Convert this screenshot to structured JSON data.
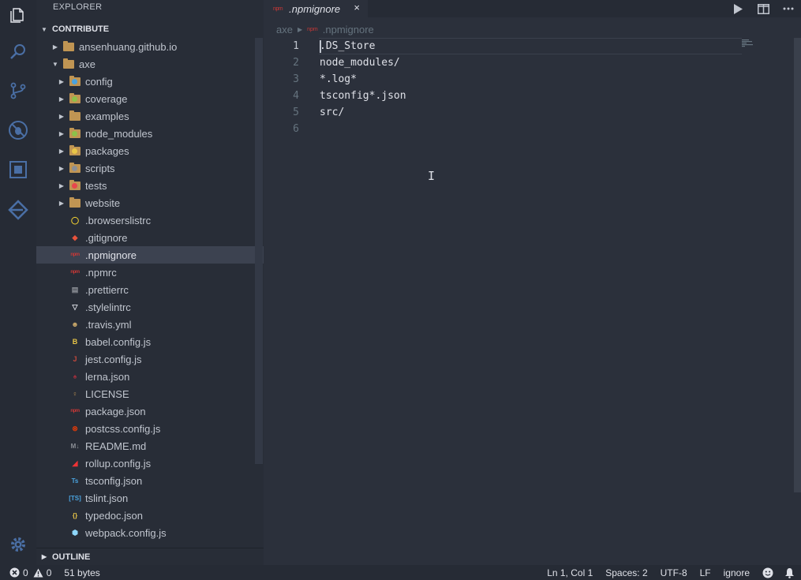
{
  "sidebar": {
    "title": "EXPLORER",
    "section": "CONTRIBUTE",
    "outline": "OUTLINE",
    "tree": [
      {
        "label": "ansenhuang.github.io",
        "kind": "folder",
        "depth": 0,
        "expanded": false,
        "icon": "folder-icon",
        "color": "#c09553"
      },
      {
        "label": "axe",
        "kind": "folder",
        "depth": 0,
        "expanded": true,
        "icon": "folder-open-icon",
        "color": "#c09553"
      },
      {
        "label": "config",
        "kind": "folder",
        "depth": 1,
        "expanded": false,
        "icon": "folder-config-icon",
        "color": "#4aa3df"
      },
      {
        "label": "coverage",
        "kind": "folder",
        "depth": 1,
        "expanded": false,
        "icon": "folder-coverage-icon",
        "color": "#8dc149"
      },
      {
        "label": "examples",
        "kind": "folder",
        "depth": 1,
        "expanded": false,
        "icon": "folder-icon",
        "color": "#c09553"
      },
      {
        "label": "node_modules",
        "kind": "folder",
        "depth": 1,
        "expanded": false,
        "icon": "folder-node-icon",
        "color": "#8dc149"
      },
      {
        "label": "packages",
        "kind": "folder",
        "depth": 1,
        "expanded": false,
        "icon": "folder-packages-icon",
        "color": "#e8c547"
      },
      {
        "label": "scripts",
        "kind": "folder",
        "depth": 1,
        "expanded": false,
        "icon": "folder-scripts-icon",
        "color": "#8b8f96"
      },
      {
        "label": "tests",
        "kind": "folder",
        "depth": 1,
        "expanded": false,
        "icon": "folder-tests-icon",
        "color": "#e8474c"
      },
      {
        "label": "website",
        "kind": "folder",
        "depth": 1,
        "expanded": false,
        "icon": "folder-icon",
        "color": "#c09553"
      },
      {
        "label": ".browserslistrc",
        "kind": "file",
        "depth": 1,
        "icon": "browserslist-icon",
        "glyph": "◯",
        "color": "#f2d131"
      },
      {
        "label": ".gitignore",
        "kind": "file",
        "depth": 1,
        "icon": "git-icon",
        "glyph": "◆",
        "color": "#e8533c"
      },
      {
        "label": ".npmignore",
        "kind": "file",
        "depth": 1,
        "icon": "npm-icon",
        "glyph": "npm",
        "color": "#cb3837",
        "selected": true
      },
      {
        "label": ".npmrc",
        "kind": "file",
        "depth": 1,
        "icon": "npm-icon",
        "glyph": "npm",
        "color": "#cb3837"
      },
      {
        "label": ".prettierrc",
        "kind": "file",
        "depth": 1,
        "icon": "prettier-icon",
        "glyph": "▤",
        "color": "#8b8f96"
      },
      {
        "label": ".stylelintrc",
        "kind": "file",
        "depth": 1,
        "icon": "stylelint-icon",
        "glyph": "▽",
        "color": "#dfe1e8"
      },
      {
        "label": ".travis.yml",
        "kind": "file",
        "depth": 1,
        "icon": "travis-icon",
        "glyph": "☻",
        "color": "#c9a86a"
      },
      {
        "label": "babel.config.js",
        "kind": "file",
        "depth": 1,
        "icon": "babel-icon",
        "glyph": "B",
        "color": "#e8c547"
      },
      {
        "label": "jest.config.js",
        "kind": "file",
        "depth": 1,
        "icon": "jest-icon",
        "glyph": "J",
        "color": "#c3483c"
      },
      {
        "label": "lerna.json",
        "kind": "file",
        "depth": 1,
        "icon": "lerna-icon",
        "glyph": "♠",
        "color": "#9b2f3c"
      },
      {
        "label": "LICENSE",
        "kind": "file",
        "depth": 1,
        "icon": "license-icon",
        "glyph": "♀",
        "color": "#c09553"
      },
      {
        "label": "package.json",
        "kind": "file",
        "depth": 1,
        "icon": "npm-icon",
        "glyph": "npm",
        "color": "#cb3837"
      },
      {
        "label": "postcss.config.js",
        "kind": "file",
        "depth": 1,
        "icon": "postcss-icon",
        "glyph": "⊗",
        "color": "#dd3a0a"
      },
      {
        "label": "README.md",
        "kind": "file",
        "depth": 1,
        "icon": "markdown-icon",
        "glyph": "M↓",
        "color": "#8b8f96"
      },
      {
        "label": "rollup.config.js",
        "kind": "file",
        "depth": 1,
        "icon": "rollup-icon",
        "glyph": "◢",
        "color": "#ef3335"
      },
      {
        "label": "tsconfig.json",
        "kind": "file",
        "depth": 1,
        "icon": "typescript-icon",
        "glyph": "Ts",
        "color": "#4aa3df"
      },
      {
        "label": "tslint.json",
        "kind": "file",
        "depth": 1,
        "icon": "tslint-icon",
        "glyph": "[TS]",
        "color": "#4aa3df"
      },
      {
        "label": "typedoc.json",
        "kind": "file",
        "depth": 1,
        "icon": "json-icon",
        "glyph": "{}",
        "color": "#e8c547"
      },
      {
        "label": "webpack.config.js",
        "kind": "file",
        "depth": 1,
        "icon": "webpack-icon",
        "glyph": "⬢",
        "color": "#8ed6fb"
      }
    ]
  },
  "editor": {
    "tab_label": ".npmignore",
    "tab_badge": "npm",
    "tab_close": "×",
    "breadcrumb_folder": "axe",
    "breadcrumb_file": ".npmignore",
    "lines": [
      {
        "n": "1",
        "text": ".DS_Store"
      },
      {
        "n": "2",
        "text": "node_modules/"
      },
      {
        "n": "3",
        "text": "*.log*"
      },
      {
        "n": "4",
        "text": "tsconfig*.json"
      },
      {
        "n": "5",
        "text": "src/"
      },
      {
        "n": "6",
        "text": ""
      }
    ]
  },
  "status": {
    "errors": "0",
    "warnings": "0",
    "size": "51 bytes",
    "position": "Ln 1, Col 1",
    "indent": "Spaces: 2",
    "encoding": "UTF-8",
    "eol": "LF",
    "language": "ignore"
  }
}
